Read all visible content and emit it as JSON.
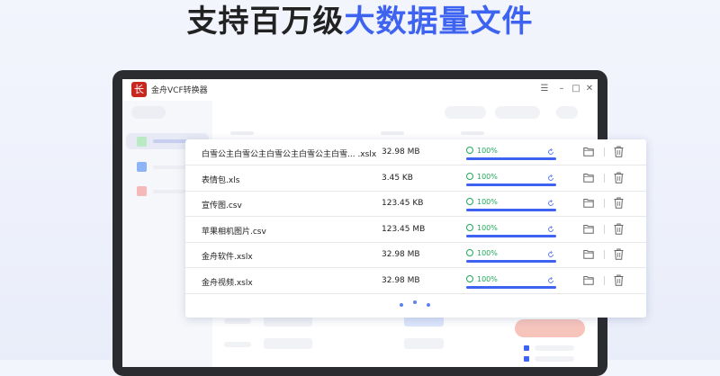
{
  "headline": {
    "prefix": "支持百万级",
    "highlight": "大数据量文件"
  },
  "app": {
    "title": "金舟VCF转换器",
    "logo_glyph": "长"
  },
  "window_controls": {
    "menu": "☰",
    "minimize": "–",
    "maximize": "□",
    "close": "✕"
  },
  "files": [
    {
      "name": "白雪公主白雪公主白雪公主白雪公主白雪... .xslx",
      "size": "32.98 MB",
      "progress_text": "100%",
      "progress": 1.0
    },
    {
      "name": "表情包.xls",
      "size": "3.45 KB",
      "progress_text": "100%",
      "progress": 1.0
    },
    {
      "name": "宣传图.csv",
      "size": "123.45 KB",
      "progress_text": "100%",
      "progress": 1.0
    },
    {
      "name": "苹果相机图片.csv",
      "size": "123.45 MB",
      "progress_text": "100%",
      "progress": 1.0
    },
    {
      "name": "金舟软件.xslx",
      "size": "32.98 MB",
      "progress_text": "100%",
      "progress": 1.0
    },
    {
      "name": "金舟视频.xslx",
      "size": "32.98 MB",
      "progress_text": "100%",
      "progress": 1.0
    }
  ],
  "icons": {
    "status": "smile-icon",
    "retry": "refresh-icon",
    "open_folder": "folder-icon",
    "delete": "trash-icon"
  },
  "colors": {
    "accent": "#3d63f0",
    "success": "#1fa95a",
    "logo": "#c8261f"
  }
}
